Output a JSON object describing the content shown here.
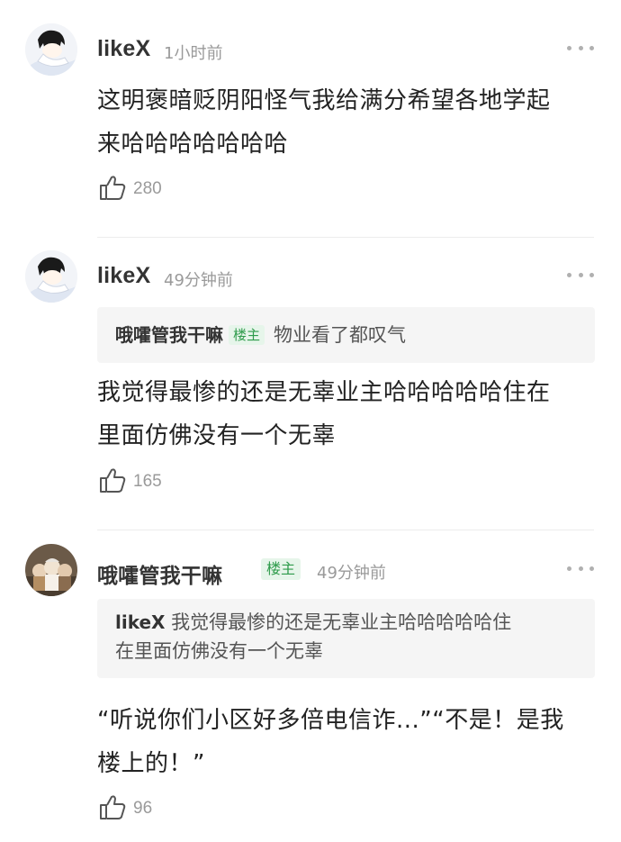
{
  "comments": [
    {
      "username": "likeX",
      "time": "1小时前",
      "badge": "",
      "quote": null,
      "text_lines": [
        "这明褒暗贬阴阳怪气我给满分希望各地学起",
        "来哈哈哈哈哈哈哈"
      ],
      "likes": "280"
    },
    {
      "username": "likeX",
      "time": "49分钟前",
      "badge": "",
      "quote": {
        "author": "哦嚯管我干嘛",
        "badge": "楼主",
        "lines": [
          "物业看了都叹气"
        ]
      },
      "text_lines": [
        "我觉得最惨的还是无辜业主哈哈哈哈哈住在",
        "里面仿佛没有一个无辜"
      ],
      "likes": "165"
    },
    {
      "username": "哦嚯管我干嘛",
      "time": "49分钟前",
      "badge": "楼主",
      "quote": {
        "author": "likeX",
        "badge": "",
        "lines": [
          "我觉得最惨的还是无辜业主哈哈哈哈哈住",
          "在里面仿佛没有一个无辜"
        ]
      },
      "text_lines": [
        "“听说你们小区好多倍电信诈...”“不是！是我",
        "楼上的！”"
      ],
      "likes": "96"
    }
  ],
  "icons": {
    "like": "thumbs-up-icon",
    "more": "more-dots-icon"
  },
  "colors": {
    "badge_green": "#2e9b4b",
    "badge_bg": "#e6f5ea",
    "meta_gray": "#9a9a9a",
    "quote_bg": "#f5f5f5"
  }
}
